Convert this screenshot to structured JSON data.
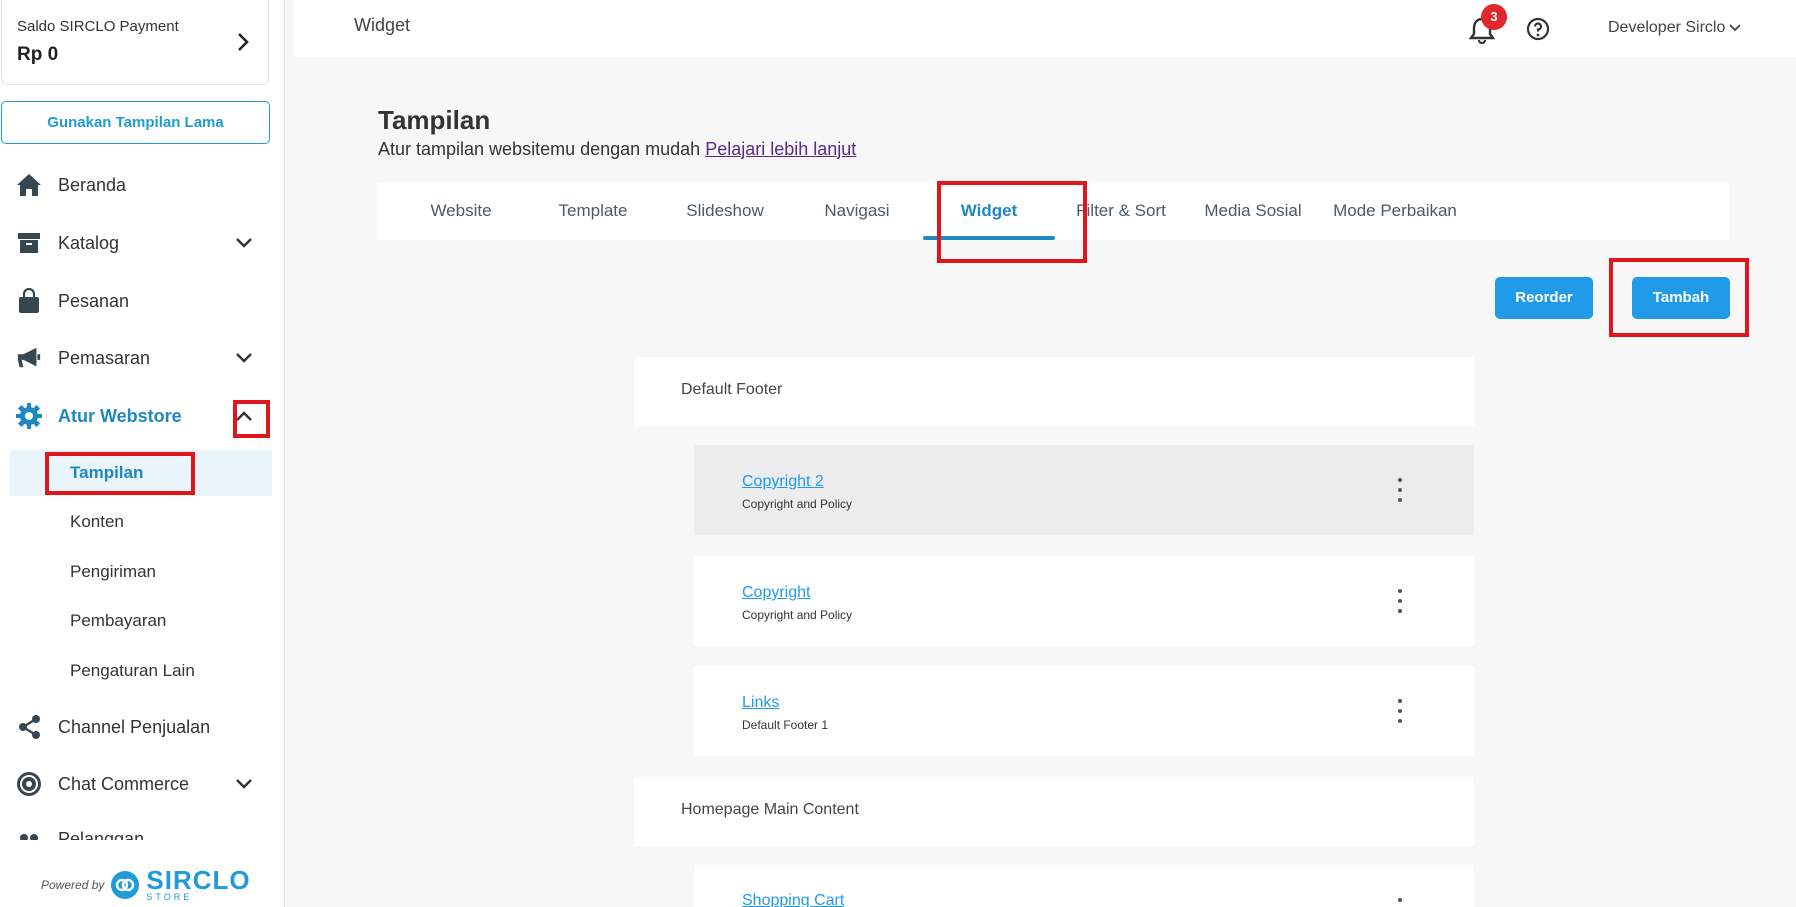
{
  "sidebar": {
    "balance": {
      "label": "Saldo SIRCLO Payment",
      "amount": "Rp 0"
    },
    "old_view_button": "Gunakan Tampilan Lama",
    "items": [
      {
        "label": "Beranda",
        "icon": "home-icon"
      },
      {
        "label": "Katalog",
        "icon": "archive-icon",
        "has_caret": true
      },
      {
        "label": "Pesanan",
        "icon": "shopping-bag-icon"
      },
      {
        "label": "Pemasaran",
        "icon": "megaphone-icon",
        "has_caret": true
      },
      {
        "label": "Atur Webstore",
        "icon": "gear-icon",
        "has_caret": true,
        "expanded": true,
        "active": true
      },
      {
        "label": "Channel Penjualan",
        "icon": "share-icon"
      },
      {
        "label": "Chat Commerce",
        "icon": "chat-commerce-icon",
        "has_caret": true
      },
      {
        "label": "Pelanggan",
        "icon": "customers-icon"
      }
    ],
    "sub_items": [
      "Tampilan",
      "Konten",
      "Pengiriman",
      "Pembayaran",
      "Pengaturan Lain"
    ],
    "active_sub_item": "Tampilan",
    "powered_by": "Powered by",
    "brand": "SIRCLO",
    "brand_sub": "STORE"
  },
  "header": {
    "page_title": "Widget",
    "notification_count": "3",
    "user_name": "Developer Sirclo"
  },
  "main": {
    "title": "Tampilan",
    "subtitle": "Atur tampilan websitemu dengan mudah",
    "learn_more": "Pelajari lebih lanjut",
    "tabs": [
      "Website",
      "Template",
      "Slideshow",
      "Navigasi",
      "Widget",
      "Filter & Sort",
      "Media Sosial",
      "Mode Perbaikan"
    ],
    "active_tab": "Widget",
    "reorder_button": "Reorder",
    "add_button": "Tambah",
    "groups": [
      {
        "name": "Default Footer",
        "widgets": [
          {
            "name": "Copyright 2",
            "desc": "Copyright and Policy",
            "highlighted": true
          },
          {
            "name": "Copyright",
            "desc": "Copyright and Policy"
          },
          {
            "name": "Links",
            "desc": "Default Footer 1"
          }
        ]
      },
      {
        "name": "Homepage Main Content",
        "widgets": [
          {
            "name": "Shopping Cart",
            "desc": ""
          }
        ]
      }
    ]
  },
  "colors": {
    "accent": "#1f9bea",
    "active_nav": "#1f88c2",
    "annotation_red": "#e0161c",
    "badge": "#e0272b"
  }
}
